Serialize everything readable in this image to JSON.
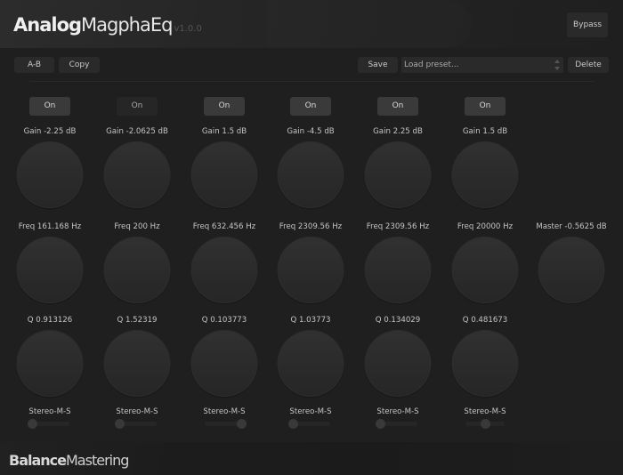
{
  "header": {
    "brand_bold": "Analog",
    "brand_light": "MagphaEq",
    "version": "v1.0.0",
    "bypass_label": "Bypass"
  },
  "toolbar": {
    "ab_label": "A-B",
    "copy_label": "Copy",
    "save_label": "Save",
    "preset_placeholder": "Load preset...",
    "delete_label": "Delete"
  },
  "bands": [
    {
      "on_label": "On",
      "enabled": true,
      "gain_label": "Gain  -2.25 dB",
      "freq_label": "Freq  161.168 Hz",
      "q_label": "Q  0.913126",
      "ms_label": "Stereo-M-S",
      "ms_value": 0
    },
    {
      "on_label": "On",
      "enabled": false,
      "gain_label": "Gain  -2.0625 dB",
      "freq_label": "Freq  200 Hz",
      "q_label": "Q  1.52319",
      "ms_label": "Stereo-M-S",
      "ms_value": 0
    },
    {
      "on_label": "On",
      "enabled": true,
      "gain_label": "Gain  1.5 dB",
      "freq_label": "Freq  632.456 Hz",
      "q_label": "Q  0.103773",
      "ms_label": "Stereo-M-S",
      "ms_value": 1
    },
    {
      "on_label": "On",
      "enabled": true,
      "gain_label": "Gain  -4.5 dB",
      "freq_label": "Freq  2309.56 Hz",
      "q_label": "Q  1.03773",
      "ms_label": "Stereo-M-S",
      "ms_value": 0
    },
    {
      "on_label": "On",
      "enabled": true,
      "gain_label": "Gain  2.25 dB",
      "freq_label": "Freq  2309.56 Hz",
      "q_label": "Q  0.134029",
      "ms_label": "Stereo-M-S",
      "ms_value": 0
    },
    {
      "on_label": "On",
      "enabled": true,
      "gain_label": "Gain  1.5 dB",
      "freq_label": "Freq  20000 Hz",
      "q_label": "Q  0.481673",
      "ms_label": "Stereo-M-S",
      "ms_value": 0.5
    }
  ],
  "master": {
    "label": "Master  -0.5625 dB"
  },
  "footer": {
    "brand_bold": "Balance",
    "brand_light": "Mastering"
  }
}
